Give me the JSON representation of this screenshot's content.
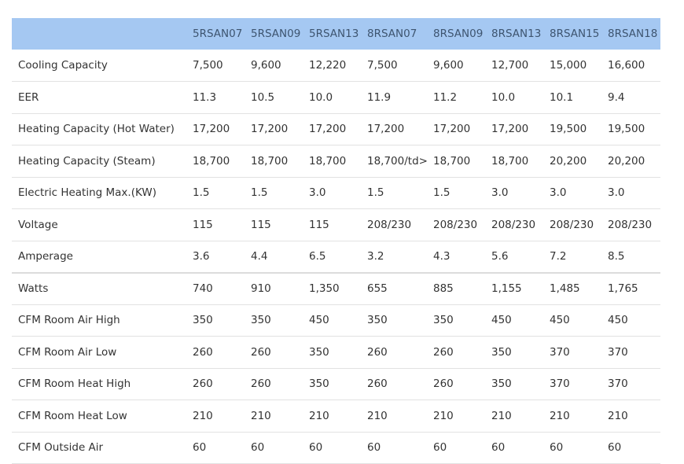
{
  "table": {
    "columns": [
      "",
      "5RSAN07",
      "5RSAN09",
      "5RSAN13",
      "8RSAN07",
      "8RSAN09",
      "8RSAN13",
      "8RSAN15",
      "8RSAN18"
    ],
    "rows": [
      {
        "label": "Cooling Capacity",
        "values": [
          "7,500",
          "9,600",
          "12,220",
          "7,500",
          "9,600",
          "12,700",
          "15,000",
          "16,600"
        ]
      },
      {
        "label": "EER",
        "values": [
          "11.3",
          "10.5",
          "10.0",
          "11.9",
          "11.2",
          "10.0",
          "10.1",
          "9.4"
        ]
      },
      {
        "label": "Heating Capacity (Hot Water)",
        "values": [
          "17,200",
          "17,200",
          "17,200",
          "17,200",
          "17,200",
          "17,200",
          "19,500",
          "19,500"
        ]
      },
      {
        "label": "Heating Capacity (Steam)",
        "values": [
          "18,700",
          "18,700",
          "18,700",
          "18,700/td>",
          "18,700",
          "18,700",
          "20,200",
          "20,200"
        ]
      },
      {
        "label": "Electric Heating Max.(KW)",
        "values": [
          "1.5",
          "1.5",
          "3.0",
          "1.5",
          "1.5",
          "3.0",
          "3.0",
          "3.0"
        ]
      },
      {
        "label": "Voltage",
        "values": [
          "115",
          "115",
          "115",
          "208/230",
          "208/230",
          "208/230",
          "208/230",
          "208/230"
        ]
      },
      {
        "label": "Amperage",
        "values": [
          "3.6",
          "4.4",
          "6.5",
          "3.2",
          "4.3",
          "5.6",
          "7.2",
          "8.5"
        ]
      },
      {
        "label": "Watts",
        "values": [
          "740",
          "910",
          "1,350",
          "655",
          "885",
          "1,155",
          "1,485",
          "1,765"
        ]
      },
      {
        "label": "CFM Room Air High",
        "values": [
          "350",
          "350",
          "450",
          "350",
          "350",
          "450",
          "450",
          "450"
        ]
      },
      {
        "label": "CFM Room Air Low",
        "values": [
          "260",
          "260",
          "350",
          "260",
          "260",
          "350",
          "370",
          "370"
        ]
      },
      {
        "label": "CFM Room Heat High",
        "values": [
          "260",
          "260",
          "350",
          "260",
          "260",
          "350",
          "370",
          "370"
        ]
      },
      {
        "label": "CFM Room Heat Low",
        "values": [
          "210",
          "210",
          "210",
          "210",
          "210",
          "210",
          "210",
          "210"
        ]
      },
      {
        "label": "CFM Outside Air",
        "values": [
          "60",
          "60",
          "60",
          "60",
          "60",
          "60",
          "60",
          "60"
        ]
      }
    ]
  },
  "colors": {
    "header_bg": "#a5c8f2",
    "header_text": "#3e5570",
    "body_text": "#333333",
    "row_border": "#e2e2e2"
  }
}
